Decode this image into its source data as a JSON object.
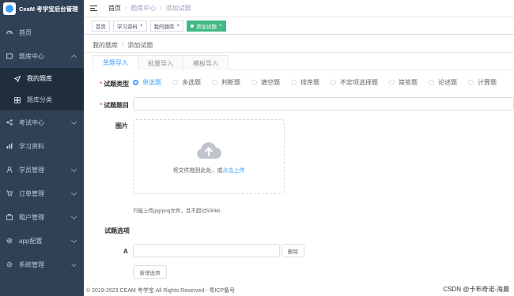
{
  "sidebar": {
    "app_title": "CeaM 考学宝后台管理",
    "items": [
      {
        "label": "首页",
        "icon": "dashboard-icon"
      },
      {
        "label": "题库中心",
        "icon": "question-bank-icon",
        "expanded": true,
        "children": [
          {
            "label": "我的题库",
            "icon": "send-icon",
            "active": true
          },
          {
            "label": "题库分类",
            "icon": "grid-icon"
          }
        ]
      },
      {
        "label": "考试中心",
        "icon": "share-icon"
      },
      {
        "label": "学习资料",
        "icon": "chart-icon"
      },
      {
        "label": "学员管理",
        "icon": "user-icon"
      },
      {
        "label": "订单管理",
        "icon": "cart-icon"
      },
      {
        "label": "租户管理",
        "icon": "tenant-icon"
      },
      {
        "label": "app配置",
        "icon": "gear-icon"
      },
      {
        "label": "系统管理",
        "icon": "system-icon"
      }
    ]
  },
  "navbar": {
    "breadcrumb": [
      "首页",
      "题库中心",
      "添加试题"
    ]
  },
  "tags": [
    {
      "label": "首页",
      "closable": false
    },
    {
      "label": "学习资料",
      "closable": true
    },
    {
      "label": "我的题库",
      "closable": true
    },
    {
      "label": "添加试题",
      "closable": true,
      "active": true
    }
  ],
  "page": {
    "breadcrumb": [
      "我的题库",
      "添加试题"
    ],
    "tabs": [
      {
        "label": "单题导入",
        "active": true
      },
      {
        "label": "批量导入"
      },
      {
        "label": "模板导入"
      }
    ],
    "form": {
      "type_label": "试题类型",
      "types": [
        {
          "label": "单选题",
          "checked": true
        },
        {
          "label": "多选题"
        },
        {
          "label": "判断题"
        },
        {
          "label": "填空题"
        },
        {
          "label": "排序题"
        },
        {
          "label": "不定项选择题"
        },
        {
          "label": "简答题"
        },
        {
          "label": "论述题"
        },
        {
          "label": "计算题"
        }
      ],
      "title_label": "试题题目",
      "title_value": "",
      "image_label": "图片",
      "upload_text": "将文件拖到此处，或",
      "upload_link": "点击上传",
      "upload_tip": "只能上传jpg/png文件，且不超过500kb",
      "options_label": "试题选项",
      "option_letter": "A",
      "option_value": "",
      "delete_label": "删除",
      "add_option_label": "新增选项"
    }
  },
  "footer": {
    "copyright": "© 2019-2023 CEAM 考学宝 All Rights Reserved - 粤ICP备号"
  },
  "watermark": "CSDN @卡布奇诺-海晨",
  "colors": {
    "sidebar_bg": "#304156",
    "primary": "#409eff",
    "active_tag": "#42b983",
    "required": "#f56c6c"
  }
}
